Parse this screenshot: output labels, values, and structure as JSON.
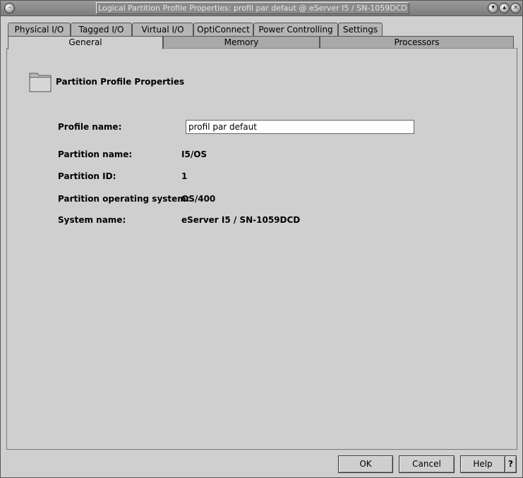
{
  "window": {
    "title": "Logical Partition Profile Properties: profil par defaut @ eServer I5 / SN-1059DCD"
  },
  "tabs_top": [
    {
      "label": "Physical I/O"
    },
    {
      "label": "Tagged I/O"
    },
    {
      "label": "Virtual I/O"
    },
    {
      "label": "OptiConnect"
    },
    {
      "label": "Power Controlling"
    },
    {
      "label": "Settings"
    }
  ],
  "tabs_bottom": [
    {
      "label": "General",
      "active": true
    },
    {
      "label": "Memory",
      "active": false
    },
    {
      "label": "Processors",
      "active": false
    }
  ],
  "general": {
    "section_title": "Partition Profile Properties",
    "profile_name_label": "Profile name:",
    "profile_name_value": "profil par defaut",
    "partition_name_label": "Partition name:",
    "partition_name_value": "I5/OS",
    "partition_id_label": "Partition ID:",
    "partition_id_value": "1",
    "os_label": "Partition operating system:",
    "os_value": "OS/400",
    "system_name_label": "System name:",
    "system_name_value": "eServer I5 / SN-1059DCD"
  },
  "buttons": {
    "ok": "OK",
    "cancel": "Cancel",
    "help": "Help",
    "context_help": "?"
  },
  "icons": {
    "window_menu": "window-menu-icon",
    "folder": "folder-icon"
  },
  "colors": {
    "background": "#cfcfcf",
    "titlebar": "#8a8a8a"
  }
}
